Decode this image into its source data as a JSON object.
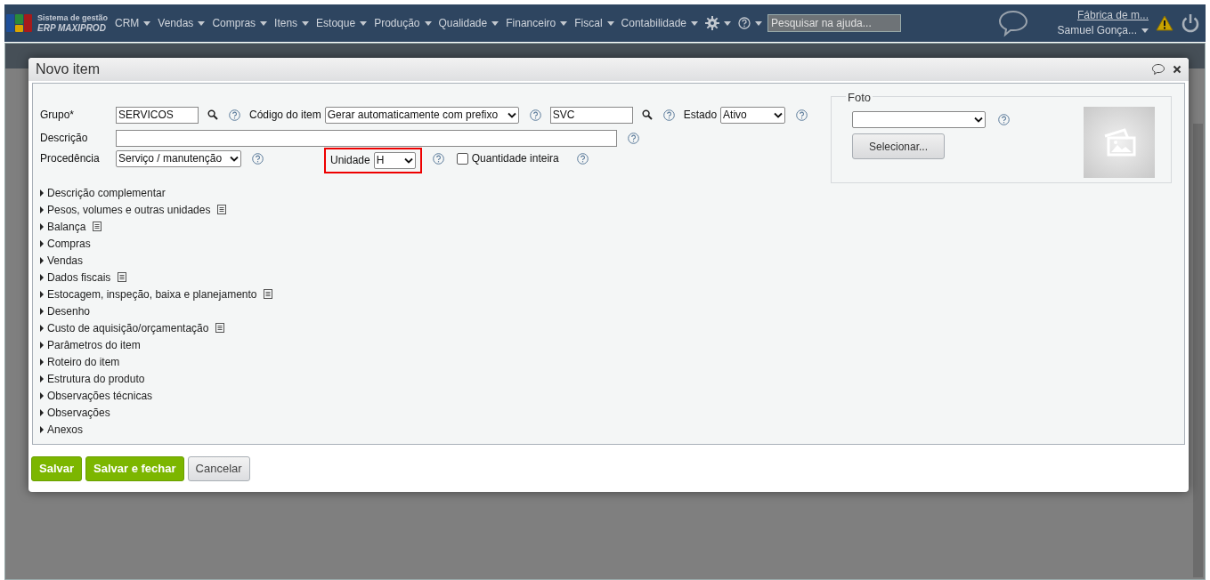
{
  "app": {
    "logo_line1": "Sistema de gestão",
    "logo_line2": "ERP MAXIPROD"
  },
  "menu": [
    {
      "label": "CRM"
    },
    {
      "label": "Vendas"
    },
    {
      "label": "Compras"
    },
    {
      "label": "Itens"
    },
    {
      "label": "Estoque"
    },
    {
      "label": "Produção"
    },
    {
      "label": "Qualidade"
    },
    {
      "label": "Financeiro"
    },
    {
      "label": "Fiscal"
    },
    {
      "label": "Contabilidade"
    }
  ],
  "help_search": {
    "placeholder": "Pesquisar na ajuda..."
  },
  "account": {
    "company": "Fábrica de m...",
    "user": "Samuel Gonça..."
  },
  "dialog": {
    "title": "Novo item",
    "rows": [
      [
        {
          "kind": "text",
          "label": "Grupo*",
          "value": "SERVICOS",
          "search": true,
          "help": true,
          "highlighted": false
        },
        {
          "kind": "select",
          "label": "Código do item",
          "value": "Gerar automaticamente com prefixo",
          "search": false,
          "help": true,
          "highlighted": false
        },
        {
          "kind": "text",
          "value": "SVC",
          "search": true,
          "help": true,
          "highlighted": false
        },
        {
          "kind": "select",
          "label": "Estado",
          "value": "Ativo",
          "search": false,
          "help": true,
          "highlighted": false
        }
      ],
      [
        {
          "kind": "text",
          "label": "Descrição",
          "search": false,
          "help": true,
          "highlighted": false
        }
      ],
      [
        {
          "kind": "select",
          "label": "Procedência",
          "value": "Serviço / manutenção",
          "search": false,
          "help": true,
          "highlighted": false
        },
        {
          "kind": "select",
          "label": "Unidade",
          "value": "H",
          "search": false,
          "help": true,
          "highlighted": true
        },
        {
          "kind": "checkbox",
          "label": "Quantidade inteira",
          "checked": false,
          "search": false,
          "help": true,
          "highlighted": false
        }
      ]
    ],
    "photo": {
      "legend": "Foto",
      "button": "Selecionar..."
    },
    "sections": [
      {
        "label": "Descrição complementar",
        "note": false
      },
      {
        "label": "Pesos, volumes e outras unidades",
        "note": true
      },
      {
        "label": "Balança",
        "note": true
      },
      {
        "label": "Compras",
        "note": false
      },
      {
        "label": "Vendas",
        "note": false
      },
      {
        "label": "Dados fiscais",
        "note": true
      },
      {
        "label": "Estocagem, inspeção, baixa e planejamento",
        "note": true
      },
      {
        "label": "Desenho",
        "note": false
      },
      {
        "label": "Custo de aquisição/orçamentação",
        "note": true
      },
      {
        "label": "Parâmetros do item",
        "note": false
      },
      {
        "label": "Roteiro do item",
        "note": false
      },
      {
        "label": "Estrutura do produto",
        "note": false
      },
      {
        "label": "Observações técnicas",
        "note": false
      },
      {
        "label": "Observações",
        "note": false
      },
      {
        "label": "Anexos",
        "note": false
      }
    ],
    "buttons": [
      {
        "label": "Salvar",
        "kind": "primary"
      },
      {
        "label": "Salvar e fechar",
        "kind": "primary"
      },
      {
        "label": "Cancelar",
        "kind": "secondary"
      }
    ]
  }
}
